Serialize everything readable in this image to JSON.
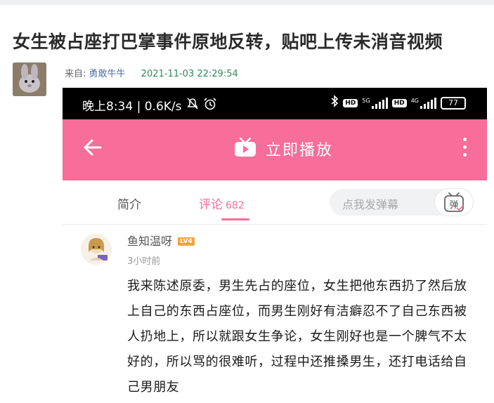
{
  "article": {
    "title": "女生被占座打巴掌事件原地反转，贴吧上传未消音视频",
    "source_label": "来自: ",
    "author": "勇敢牛牛",
    "timestamp": "2021-11-03 22:29:54"
  },
  "phone": {
    "status_bar": {
      "time": "晚上8:34",
      "speed": "0.6K/s",
      "network_1": "5G",
      "network_2": "4G",
      "hd_badge": "HD",
      "battery": "77"
    },
    "header": {
      "play_label": "立即播放",
      "icons": [
        "back-arrow-icon",
        "tv-play-icon",
        "more-vertical-icon"
      ]
    },
    "tabs": {
      "intro": "简介",
      "comments": "评论",
      "comments_count": "682",
      "danmaku_placeholder": "点我发弹幕",
      "danmaku_button": "弹"
    },
    "comment": {
      "username": "鱼知温呀",
      "level": "LV4",
      "time": "3小时前",
      "text": "我来陈述原委，男生先占的座位，女生把他东西扔了然后放上自己的东西占座位，而男生刚好有洁癖忍不了自己东西被人扔地上，所以就跟女生争论，女生刚好也是一个脾气不太好的，所以骂的很难听，过程中还推搡男生，还打电话给自己男朋友"
    }
  },
  "colors": {
    "pink": "#f86d99",
    "status_bar": "#000000",
    "timestamp_green": "#2e8b57",
    "author_blue": "#4d6fa8"
  }
}
